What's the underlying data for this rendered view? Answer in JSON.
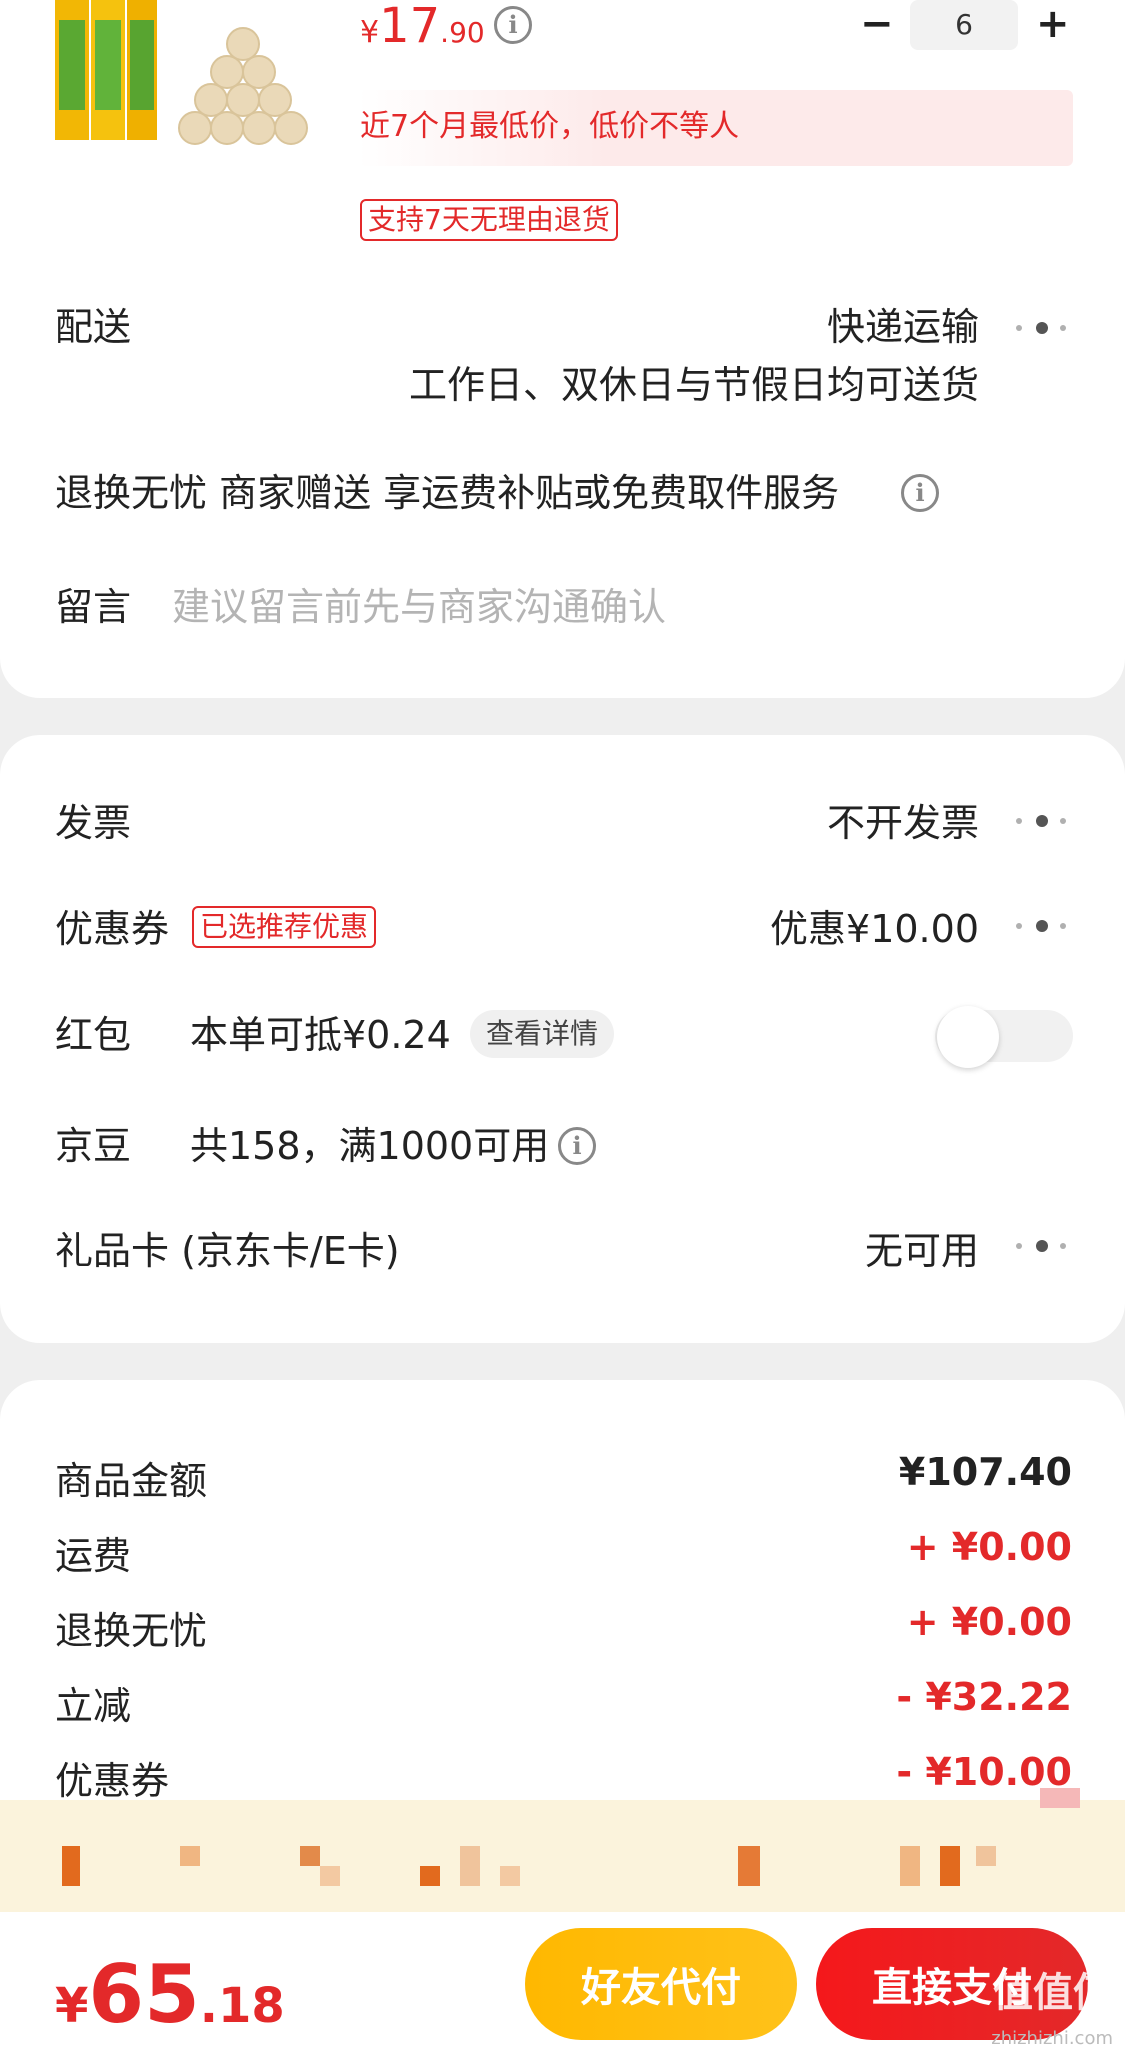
{
  "product": {
    "price_symbol": "¥",
    "price_int": "17",
    "price_dec": ".90",
    "quantity": "6",
    "minus": "−",
    "plus": "+",
    "low_price_note": "近7个月最低价，低价不等人",
    "return_tag": "支持7天无理由退货"
  },
  "delivery": {
    "label": "配送",
    "method": "快递运输",
    "schedule": "工作日、双休日与节假日均可送货"
  },
  "service": {
    "text": "退换无忧 商家赠送 享运费补贴或免费取件服务"
  },
  "message": {
    "label": "留言",
    "placeholder": "建议留言前先与商家沟通确认"
  },
  "invoice": {
    "label": "发票",
    "value": "不开发票"
  },
  "coupon": {
    "label": "优惠券",
    "tag": "已选推荐优惠",
    "value": "优惠¥10.00"
  },
  "red_packet": {
    "label": "红包",
    "desc": "本单可抵¥0.24",
    "detail_button": "查看详情",
    "enabled": false
  },
  "jd_beans": {
    "label": "京豆",
    "desc": "共158，满1000可用"
  },
  "gift_card": {
    "label": "礼品卡 (京东卡/E卡)",
    "value": "无可用"
  },
  "summary": [
    {
      "label": "商品金额",
      "value": "¥107.40",
      "color": "#222222"
    },
    {
      "label": "运费",
      "value": "+ ¥0.00",
      "color": "#e3292a"
    },
    {
      "label": "退换无忧",
      "value": "+ ¥0.00",
      "color": "#e3292a"
    },
    {
      "label": "立减",
      "value": "- ¥32.22",
      "color": "#e3292a"
    },
    {
      "label": "优惠券",
      "value": "- ¥10.00",
      "color": "#e3292a"
    }
  ],
  "total": {
    "symbol": "¥",
    "int": "65",
    "dec": ".18"
  },
  "buttons": {
    "friend_pay": "好友代付",
    "direct_pay": "直接支付"
  },
  "watermark": {
    "main": "值值值",
    "sub": "zhizhizhi.com"
  },
  "colors": {
    "accent_red": "#e3292a",
    "friend_yellow": "#ffb800",
    "promo_bg": "#fbf3dc"
  }
}
